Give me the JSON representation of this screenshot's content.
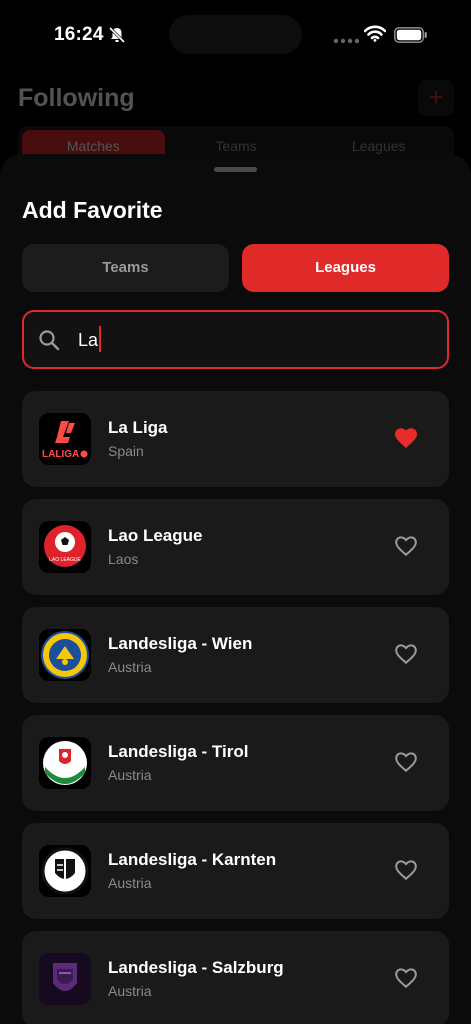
{
  "status_bar": {
    "time": "16:24"
  },
  "background_page": {
    "title": "Following",
    "add_label": "+",
    "tabs": [
      {
        "label": "Matches",
        "active": true
      },
      {
        "label": "Teams",
        "active": false
      },
      {
        "label": "Leagues",
        "active": false
      }
    ]
  },
  "sheet": {
    "title": "Add Favorite",
    "segments": {
      "teams_label": "Teams",
      "leagues_label": "Leagues",
      "selected": "Leagues"
    },
    "search": {
      "value": "La"
    },
    "results": [
      {
        "name": "La Liga",
        "country": "Spain",
        "favorited": true,
        "logo_icon": "laliga-logo"
      },
      {
        "name": "Lao League",
        "country": "Laos",
        "favorited": false,
        "logo_icon": "lao-league-logo"
      },
      {
        "name": "Landesliga - Wien",
        "country": "Austria",
        "favorited": false,
        "logo_icon": "wien-crest-logo"
      },
      {
        "name": "Landesliga - Tirol",
        "country": "Austria",
        "favorited": false,
        "logo_icon": "tirol-crest-logo"
      },
      {
        "name": "Landesliga - Karnten",
        "country": "Austria",
        "favorited": false,
        "logo_icon": "karnten-crest-logo"
      },
      {
        "name": "Landesliga - Salzburg",
        "country": "Austria",
        "favorited": false,
        "logo_icon": "salzburg-crest-logo"
      }
    ]
  },
  "colors": {
    "accent": "#e02a2a",
    "background": "#000000",
    "card": "#1a1a1a",
    "secondary_text": "#8a8a8a"
  }
}
